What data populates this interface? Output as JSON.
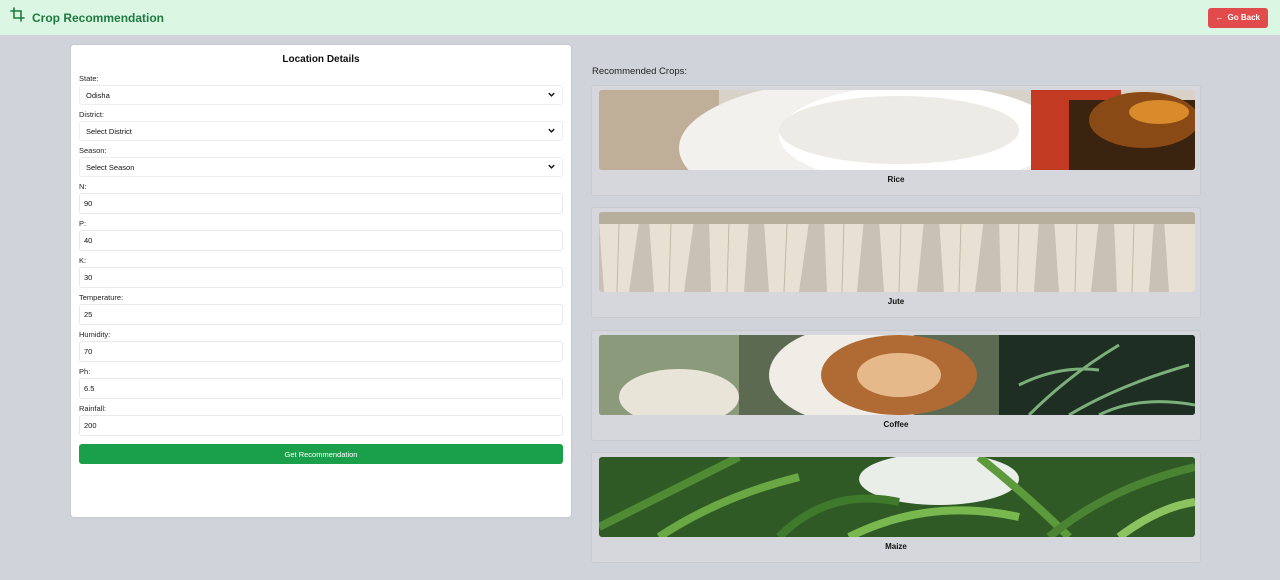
{
  "header": {
    "title": "Crop Recommendation",
    "back_label": "Go Back"
  },
  "form": {
    "title": "Location Details",
    "state": {
      "label": "State:",
      "value": "Odisha"
    },
    "district": {
      "label": "District:",
      "value": "Select District"
    },
    "season": {
      "label": "Season:",
      "value": "Select Season"
    },
    "n": {
      "label": "N:",
      "value": "90"
    },
    "p": {
      "label": "P:",
      "value": "40"
    },
    "k": {
      "label": "K:",
      "value": "30"
    },
    "temperature": {
      "label": "Temperature:",
      "value": "25"
    },
    "humidity": {
      "label": "Humidity:",
      "value": "70"
    },
    "ph": {
      "label": "Ph:",
      "value": "6.5"
    },
    "rainfall": {
      "label": "Rainfall:",
      "value": "200"
    },
    "submit_label": "Get Recommendation"
  },
  "results": {
    "heading": "Recommended Crops:",
    "crops": [
      {
        "name": "Rice"
      },
      {
        "name": "Jute"
      },
      {
        "name": "Coffee"
      },
      {
        "name": "Maize"
      }
    ]
  }
}
